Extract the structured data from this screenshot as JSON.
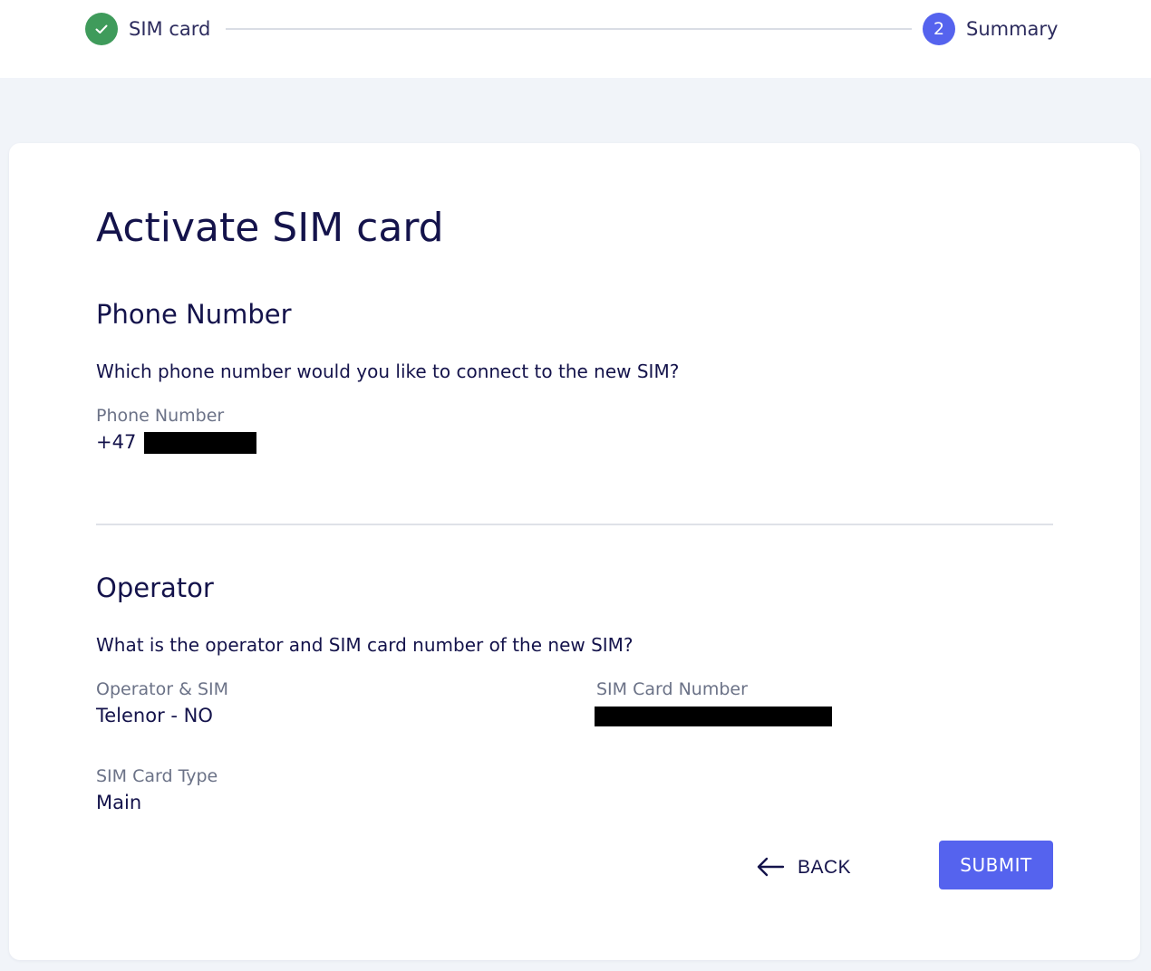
{
  "stepper": {
    "steps": [
      {
        "number": "",
        "label": "SIM card",
        "state": "done"
      },
      {
        "number": "2",
        "label": "Summary",
        "state": "active"
      }
    ]
  },
  "page": {
    "title": "Activate SIM card"
  },
  "phone_section": {
    "heading": "Phone Number",
    "question": "Which phone number would you like to connect to the new SIM?",
    "field_label": "Phone Number",
    "prefix": "+47"
  },
  "operator_section": {
    "heading": "Operator",
    "question": "What is the operator and SIM card number of the new SIM?",
    "operator_label": "Operator & SIM",
    "operator_value": "Telenor - NO",
    "sim_number_label": "SIM Card Number",
    "sim_type_label": "SIM Card Type",
    "sim_type_value": "Main"
  },
  "actions": {
    "back_label": "BACK",
    "submit_label": "SUBMIT"
  },
  "colors": {
    "accent": "#5563ee",
    "success": "#3f9b5b",
    "text": "#14134b",
    "muted": "#6b7287",
    "background": "#f1f4f9"
  }
}
